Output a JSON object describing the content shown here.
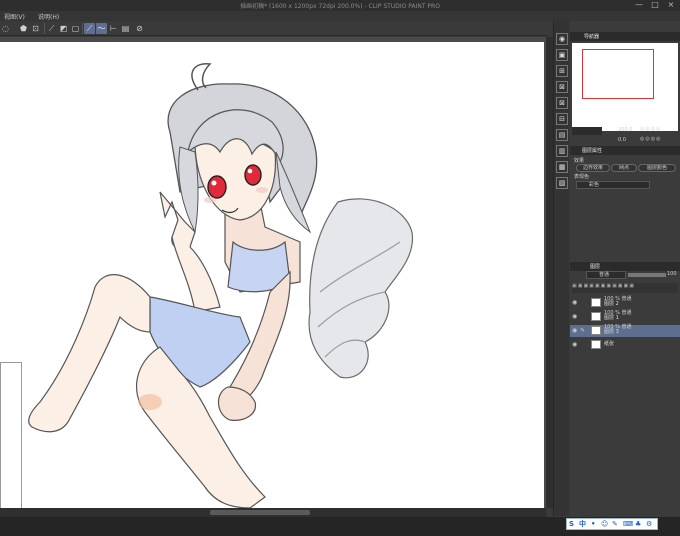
{
  "window": {
    "title": "插画初稿* (1600 x 1200px 72dpi 200.0%) - CLIP STUDIO PAINT PRO",
    "controls": [
      "—",
      "□",
      "×"
    ]
  },
  "menu": {
    "items": [
      "视图(V)",
      "说明(H)"
    ]
  },
  "toolbar": {
    "icons": [
      "transform-icon",
      "fill-icon",
      "selection-icon",
      "crop-icon",
      "stroke-icon",
      "pen-icon",
      "ruler-icon",
      "layer-icon"
    ]
  },
  "tool_column": {
    "icons": [
      "zoom-icon",
      "navigator-icon",
      "sub-view-icon",
      "color-icon",
      "layer-prop-icon",
      "history-icon",
      "material-icon",
      "library-icon",
      "timeline-icon"
    ]
  },
  "navigator": {
    "tabs": [
      "导航器",
      "",
      ""
    ],
    "zoom_value": "200.0",
    "angle_value": "0.0"
  },
  "layer_property": {
    "tabs": [
      "图层属性",
      "",
      ""
    ],
    "effect_label": "效果",
    "buttons": [
      "边界效果",
      "网点",
      "图层颜色"
    ],
    "expression_label": "表现色",
    "expression_value": "彩色"
  },
  "layers": {
    "tabs": [
      "图层",
      "",
      ""
    ],
    "blend_mode": "普通",
    "opacity": "100",
    "items": [
      {
        "opacity": "100 % 普通",
        "name": "图层 2",
        "selected": false
      },
      {
        "opacity": "100 % 普通",
        "name": "图层 1",
        "selected": false
      },
      {
        "opacity": "100 % 普通",
        "name": "图层 3",
        "selected": true
      },
      {
        "opacity": "",
        "name": "纸张",
        "selected": false
      }
    ]
  },
  "ime": {
    "mode": "中",
    "icons": [
      "punctuation-icon",
      "emoji-icon",
      "pen-icon",
      "keyboard-icon",
      "skin-icon",
      "settings-icon"
    ]
  },
  "colors": {
    "accent_selected": "#5e6e8e",
    "ime_blue": "#1a5fcc"
  }
}
